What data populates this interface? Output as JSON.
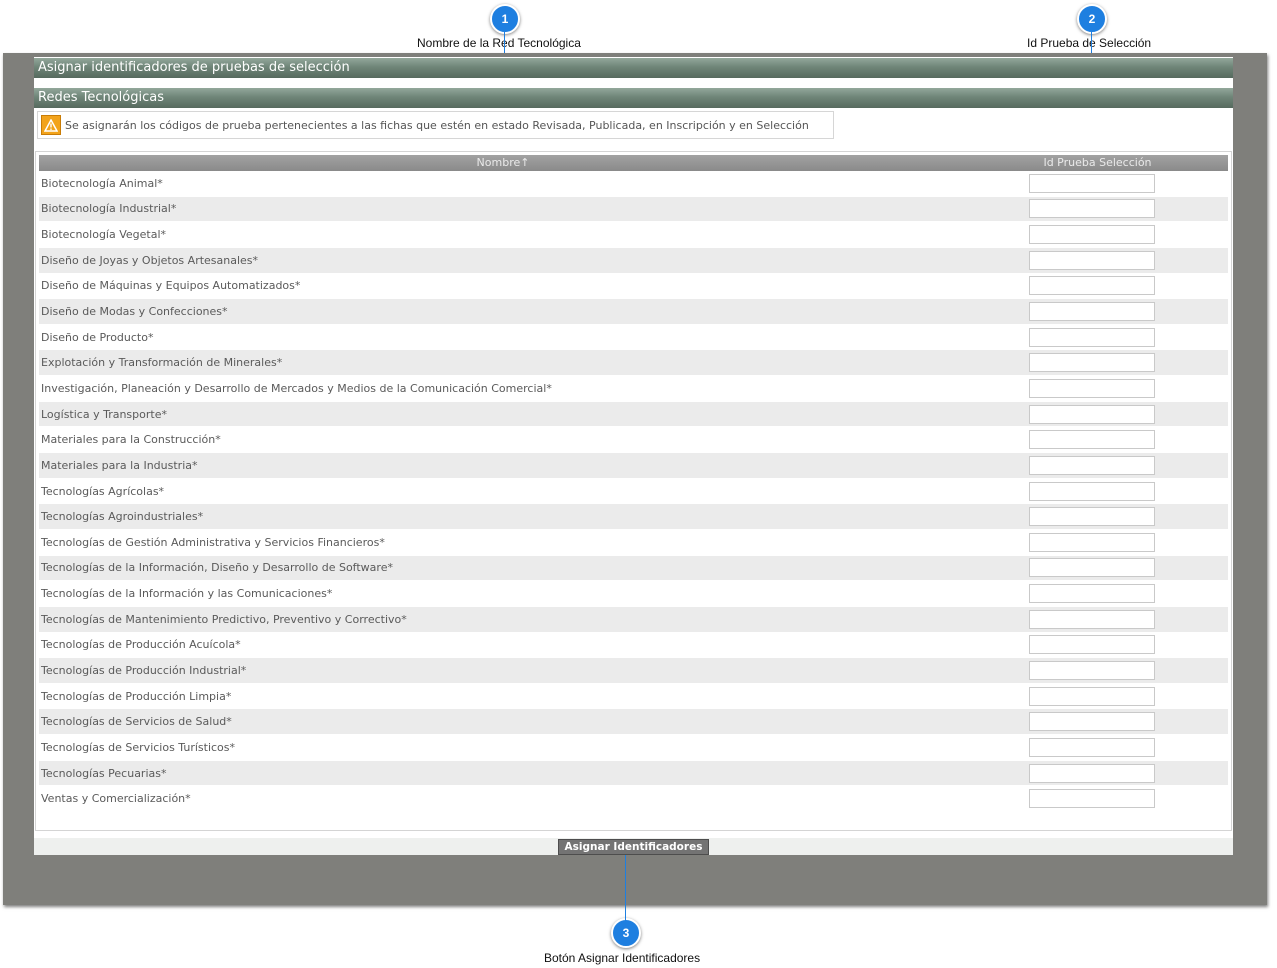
{
  "callouts": [
    {
      "number": "1",
      "label": "Nombre de la Red Tecnológica"
    },
    {
      "number": "2",
      "label": "Id Prueba de Selección"
    },
    {
      "number": "3",
      "label": "Botón Asignar Identificadores"
    }
  ],
  "panel": {
    "title": "Asignar identificadores de pruebas de selección",
    "subtitle": "Redes Tecnológicas",
    "warning_icon": "warning-icon",
    "warning_text": "Se asignarán los códigos de prueba pertenecientes a las fichas que estén en estado Revisada, Publicada, en Inscripción y en Selección"
  },
  "table": {
    "columns": [
      "Nombre↑",
      "Id Prueba Selección"
    ],
    "rows": [
      "Biotecnología Animal*",
      "Biotecnología Industrial*",
      "Biotecnología Vegetal*",
      "Diseño de Joyas y Objetos Artesanales*",
      "Diseño de Máquinas y Equipos Automatizados*",
      "Diseño de Modas y Confecciones*",
      "Diseño de Producto*",
      "Explotación y Transformación de Minerales*",
      "Investigación, Planeación y Desarrollo de Mercados y Medios de la Comunicación Comercial*",
      "Logística y Transporte*",
      "Materiales para la Construcción*",
      "Materiales para la Industria*",
      "Tecnologías Agrícolas*",
      "Tecnologías Agroindustriales*",
      "Tecnologías de Gestión Administrativa y Servicios Financieros*",
      "Tecnologías de la Información, Diseño y Desarrollo de Software*",
      "Tecnologías de la Información y las Comunicaciones*",
      "Tecnologías de Mantenimiento Predictivo, Preventivo y Correctivo*",
      "Tecnologías de Producción Acuícola*",
      "Tecnologías de Producción Industrial*",
      "Tecnologías de Producción Limpia*",
      "Tecnologías de Servicios de Salud*",
      "Tecnologías de Servicios Turísticos*",
      "Tecnologías Pecuarias*",
      "Ventas y Comercialización*"
    ]
  },
  "footer": {
    "button_label": "Asignar Identificadores"
  },
  "colors": {
    "callout": "#1e7fe0",
    "section_bar": "#6f8578",
    "frame": "#7f7f7b"
  }
}
